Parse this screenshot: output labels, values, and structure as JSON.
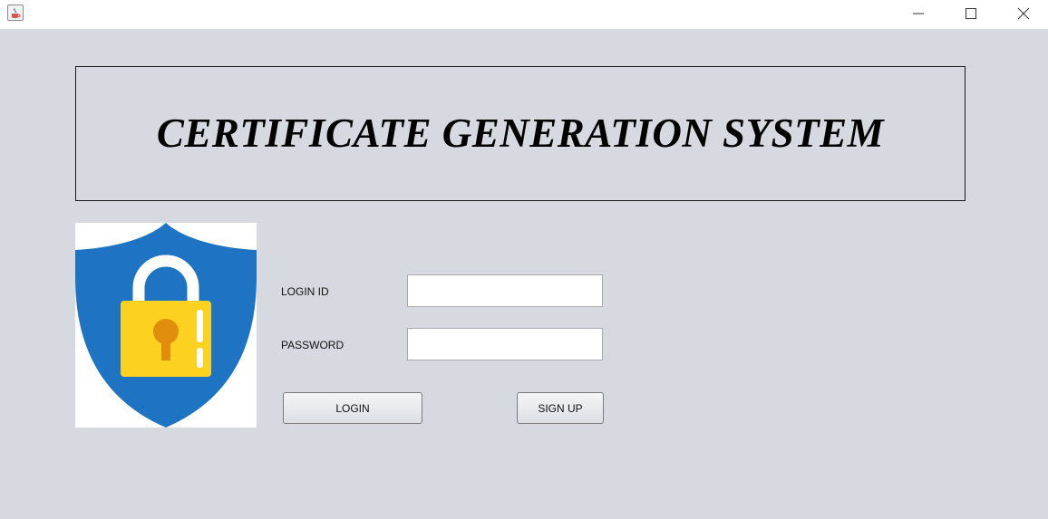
{
  "window": {
    "icon": "java-cup-icon",
    "controls": [
      "minimize-icon",
      "maximize-icon",
      "close-icon"
    ]
  },
  "header": {
    "title": "CERTIFICATE GENERATION SYSTEM"
  },
  "image": {
    "icon": "shield-lock-icon",
    "colors": {
      "shield": "#1e74c2",
      "lock_body": "#fdd11f",
      "keyhole": "#e08e0b",
      "shackle": "#ffffff"
    }
  },
  "form": {
    "login_id_label": "LOGIN ID",
    "login_id_value": "",
    "password_label": "PASSWORD",
    "password_value": "",
    "login_button": "LOGIN",
    "signup_button": "SIGN UP"
  },
  "colors": {
    "background": "#d6d9e0",
    "titlebar": "#ffffff"
  }
}
